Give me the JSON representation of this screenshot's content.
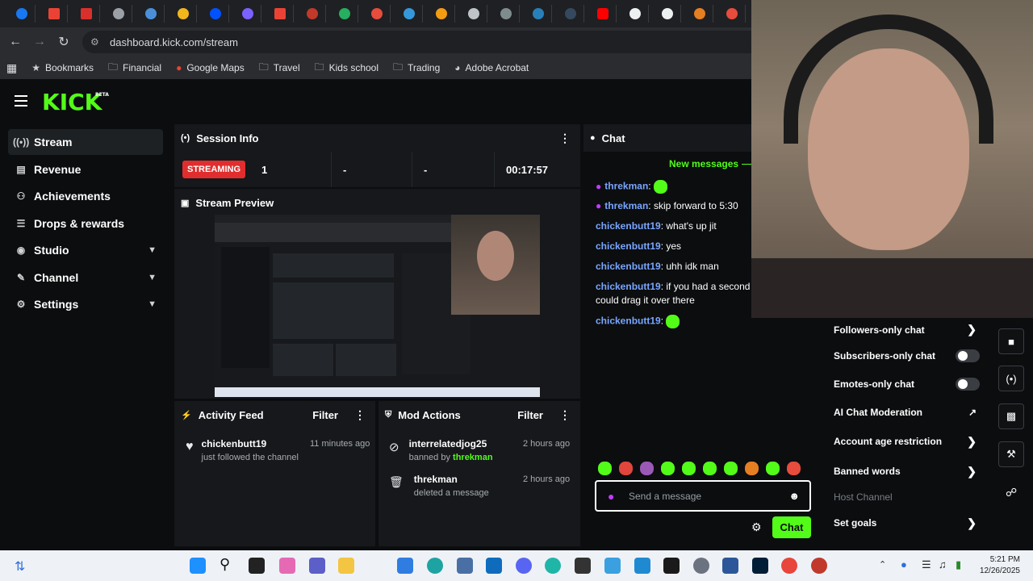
{
  "browser": {
    "url": "dashboard.kick.com/stream",
    "bookmarks": [
      "Bookmarks",
      "Financial",
      "Google Maps",
      "Travel",
      "Kids school",
      "Trading",
      "Adobe Acrobat"
    ]
  },
  "app": {
    "logo": "KICK",
    "logo_badge": "BETA"
  },
  "sidebar": {
    "items": [
      {
        "label": "Stream",
        "icon": "broadcast-icon"
      },
      {
        "label": "Revenue",
        "icon": "chart-icon"
      },
      {
        "label": "Achievements",
        "icon": "trophy-icon"
      },
      {
        "label": "Drops & rewards",
        "icon": "gift-icon"
      },
      {
        "label": "Studio",
        "icon": "studio-icon"
      },
      {
        "label": "Channel",
        "icon": "channel-icon"
      },
      {
        "label": "Settings",
        "icon": "gear-icon"
      }
    ]
  },
  "session": {
    "title": "Session Info",
    "status": "STREAMING",
    "viewers": "1",
    "stat2": "-",
    "stat3": "-",
    "duration": "00:17:57"
  },
  "preview": {
    "title": "Stream Preview"
  },
  "activity": {
    "title": "Activity Feed",
    "filter": "Filter",
    "items": [
      {
        "name": "chickenbutt19",
        "desc": "just followed the channel",
        "time": "11 minutes ago"
      }
    ]
  },
  "mod_actions": {
    "title": "Mod Actions",
    "filter": "Filter",
    "items": [
      {
        "name": "interrelatedjog25",
        "desc_prefix": "banned by",
        "by": "threkman",
        "time": "2 hours ago"
      },
      {
        "name": "threkman",
        "desc": "deleted a message",
        "time": "2 hours ago"
      }
    ]
  },
  "chat": {
    "title": "Chat",
    "new_messages": "New messages",
    "messages": [
      {
        "user": "threkman",
        "text": "",
        "emote": true
      },
      {
        "user": "threkman",
        "text": "skip forward to 5:30"
      },
      {
        "user": "chickenbutt19",
        "text": "what's up jit"
      },
      {
        "user": "chickenbutt19",
        "text": "yes"
      },
      {
        "user": "chickenbutt19",
        "text": "uhh idk man"
      },
      {
        "user": "chickenbutt19",
        "text": "if you had a second m",
        "cont": "could drag it over there"
      },
      {
        "user": "chickenbutt19",
        "text": "",
        "emote": true
      }
    ],
    "placeholder": "Send a message",
    "send_label": "Chat"
  },
  "chat_settings": {
    "items": [
      {
        "label": "Followers-only chat",
        "control": "chevron"
      },
      {
        "label": "Subscribers-only chat",
        "control": "toggle"
      },
      {
        "label": "Emotes-only chat",
        "control": "toggle"
      },
      {
        "label": "AI Chat Moderation",
        "control": "external"
      },
      {
        "label": "Account age restriction",
        "control": "chevron"
      },
      {
        "label": "Banned words",
        "control": "chevron"
      },
      {
        "label": "Host Channel",
        "control": "none"
      },
      {
        "label": "Set goals",
        "control": "chevron"
      }
    ]
  },
  "taskbar": {
    "time": "5:21 PM",
    "date": "12/26/2025"
  },
  "colors": {
    "brand": "#53fc18",
    "live": "#e12d2d",
    "username": "#7aa6ff"
  }
}
